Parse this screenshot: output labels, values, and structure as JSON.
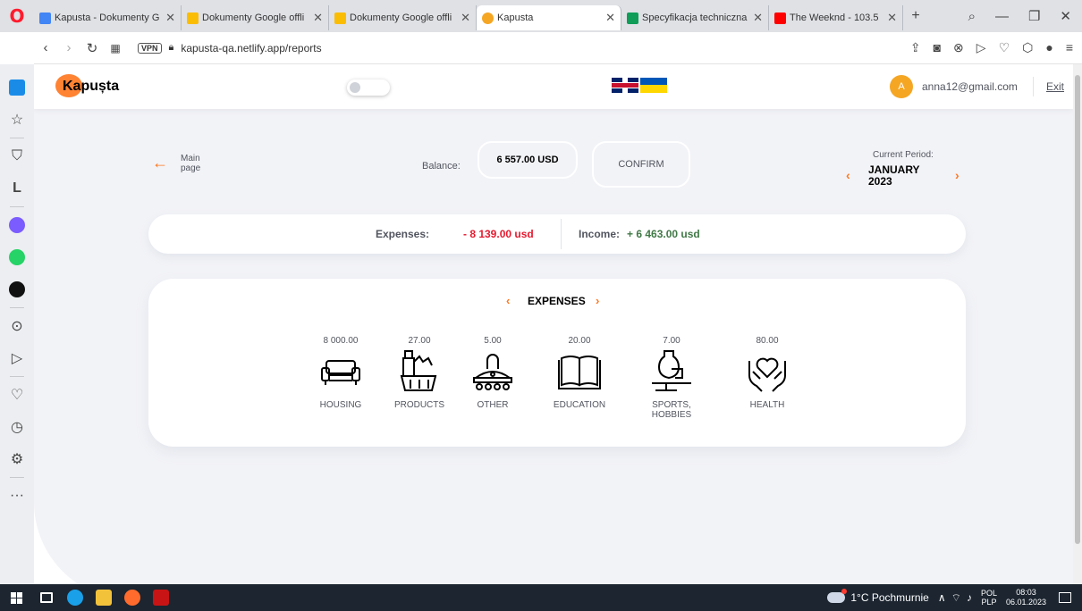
{
  "browser": {
    "tabs": [
      {
        "title": "Kapusta - Dokumenty G",
        "fav": "#4285f4",
        "close": "✕"
      },
      {
        "title": "Dokumenty Google offli",
        "fav": "#fbbc04",
        "close": "✕"
      },
      {
        "title": "Dokumenty Google offli",
        "fav": "#fbbc04",
        "close": "✕"
      },
      {
        "title": "Kapusta",
        "fav": "#f5a623",
        "close": "✕"
      },
      {
        "title": "Specyfikacja techniczna",
        "fav": "#0f9d58",
        "close": "✕"
      },
      {
        "title": "The Weeknd - 103.5",
        "fav": "#ff0000",
        "close": "✕"
      }
    ],
    "new_tab": "+",
    "url": "kapusta-qa.netlify.app/reports",
    "vpn": "VPN"
  },
  "header": {
    "logo": "Kapușta",
    "avatar_letter": "A",
    "email": "anna12@gmail.com",
    "exit": "Exit"
  },
  "controls": {
    "main_page": "Main page",
    "balance_label": "Balance:",
    "balance_value": "6 557.00 USD",
    "confirm": "CONFIRM",
    "period_label": "Current Period:",
    "period_month": "JANUARY 2023"
  },
  "summary": {
    "expenses_label": "Expenses:",
    "expenses_value": "- 8 139.00 usd",
    "income_label": "Income:",
    "income_value": "+ 6 463.00 usd"
  },
  "card": {
    "title": "EXPENSES",
    "categories": [
      {
        "amount": "8 000.00",
        "label": "HOUSING",
        "icon": "sofa-icon"
      },
      {
        "amount": "27.00",
        "label": "PRODUCTS",
        "icon": "groceries-icon"
      },
      {
        "amount": "5.00",
        "label": "OTHER",
        "icon": "ufo-icon"
      },
      {
        "amount": "20.00",
        "label": "EDUCATION",
        "icon": "book-icon"
      },
      {
        "amount": "7.00",
        "label": "SPORTS, HOBBIES",
        "icon": "pottery-icon"
      },
      {
        "amount": "80.00",
        "label": "HEALTH",
        "icon": "heart-hands-icon"
      }
    ]
  },
  "taskbar": {
    "weather": "1°C Pochmurnie",
    "lang_top": "POL",
    "lang_bottom": "PLP",
    "time": "08:03",
    "date": "06.01.2023"
  },
  "colors": {
    "accent": "#ff751d",
    "expense": "#e7192e",
    "income": "#407946",
    "text": "#52555f"
  }
}
